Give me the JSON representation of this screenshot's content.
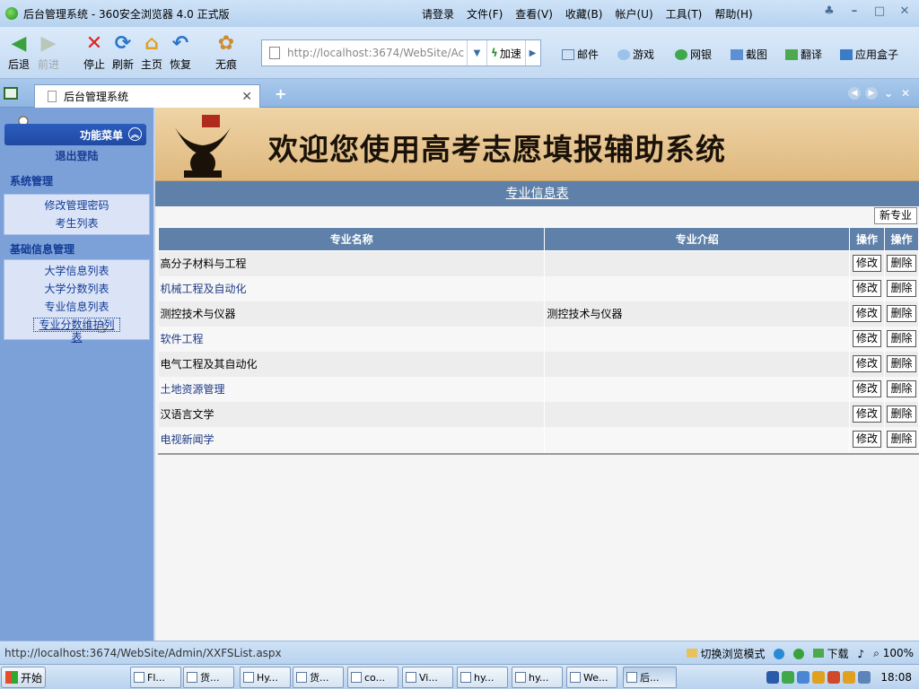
{
  "window": {
    "title": "后台管理系统 - 360安全浏览器 4.0 正式版",
    "menu": [
      "请登录",
      "文件(F)",
      "查看(V)",
      "收藏(B)",
      "帐户(U)",
      "工具(T)",
      "帮助(H)"
    ]
  },
  "toolbar": {
    "back": "后退",
    "forward": "前进",
    "stop": "停止",
    "refresh": "刷新",
    "home": "主页",
    "restore": "恢复",
    "incognito": "无痕",
    "url": "http://localhost:3674/WebSite/Ac",
    "speed": "加速",
    "quick": [
      "邮件",
      "游戏",
      "网银",
      "截图",
      "翻译",
      "应用盒子"
    ]
  },
  "tabs": {
    "active_title": "后台管理系统"
  },
  "sidebar": {
    "header": "功能菜单",
    "logout": "退出登陆",
    "groups": [
      {
        "title": "系统管理",
        "items": [
          "修改管理密码",
          "考生列表"
        ]
      },
      {
        "title": "基础信息管理",
        "items": [
          "大学信息列表",
          "大学分数列表",
          "专业信息列表",
          "专业分数维护列表"
        ]
      }
    ]
  },
  "main": {
    "banner": "欢迎您使用高考志愿填报辅助系统",
    "section_title": "专业信息表",
    "new_button": "新专业",
    "columns": [
      "专业名称",
      "专业介绍",
      "操作",
      "操作"
    ],
    "edit_label": "修改",
    "delete_label": "删除",
    "rows": [
      {
        "name": "高分子材料与工程",
        "intro": ""
      },
      {
        "name": "机械工程及自动化",
        "intro": ""
      },
      {
        "name": "测控技术与仪器",
        "intro": "测控技术与仪器"
      },
      {
        "name": "软件工程",
        "intro": ""
      },
      {
        "name": "电气工程及其自动化",
        "intro": ""
      },
      {
        "name": "土地资源管理",
        "intro": ""
      },
      {
        "name": "汉语言文学",
        "intro": ""
      },
      {
        "name": "电视新闻学",
        "intro": ""
      }
    ]
  },
  "statusbar": {
    "url": "http://localhost:3674/WebSite/Admin/XXFSList.aspx",
    "mode": "切换浏览模式",
    "download": "下载",
    "zoom": "100%"
  },
  "taskbar": {
    "start": "开始",
    "tasks": [
      "Fl...",
      "货...",
      "Hy...",
      "货...",
      "co...",
      "Vi...",
      "hy...",
      "hy...",
      "We...",
      "后..."
    ],
    "time": "18:08"
  },
  "colors": {
    "sidebar_bg": "#7ca0d8",
    "header_bar": "#5f80a8",
    "link": "#123c96"
  }
}
